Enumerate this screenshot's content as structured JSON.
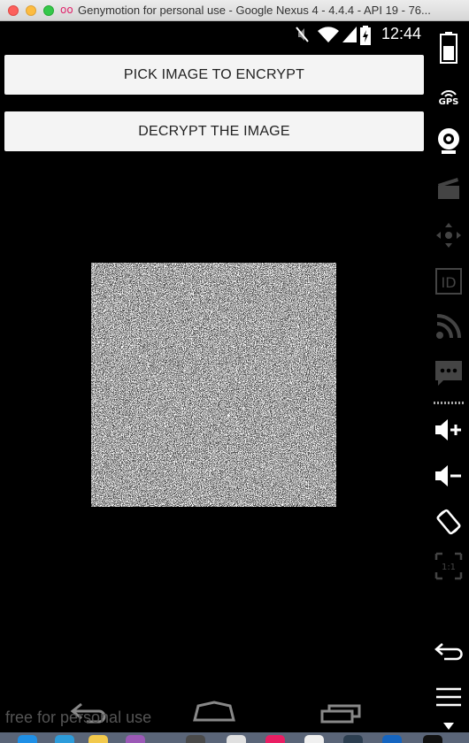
{
  "window": {
    "title": "Genymotion for personal use - Google Nexus 4 - 4.4.4 - API 19 - 76...",
    "app_icon": "oo"
  },
  "statusbar": {
    "time": "12:44"
  },
  "buttons": {
    "encrypt_label": "PICK IMAGE TO ENCRYPT",
    "decrypt_label": "DECRYPT THE IMAGE"
  },
  "watermark": "free for personal use",
  "sidebar": {
    "gps_label": "GPS",
    "id_label": "ID",
    "ratio_label": "1:1"
  },
  "icons": {
    "battery": "battery-icon",
    "gps": "gps-icon",
    "webcam": "webcam-icon",
    "capture": "clapperboard-icon",
    "remote": "dpad-icon",
    "identifiers": "id-icon",
    "network": "network-icon",
    "sms": "sms-icon",
    "volume_up": "volume-up-icon",
    "volume_down": "volume-down-icon",
    "rotate": "rotate-icon",
    "scale": "pixel-perfect-icon",
    "back": "back-icon",
    "home": "home-icon",
    "recents": "recents-icon"
  },
  "colors": {
    "close": "#fc605c",
    "minimize": "#fdbc40",
    "maximize": "#34c84a",
    "button_bg": "#f4f4f4"
  }
}
